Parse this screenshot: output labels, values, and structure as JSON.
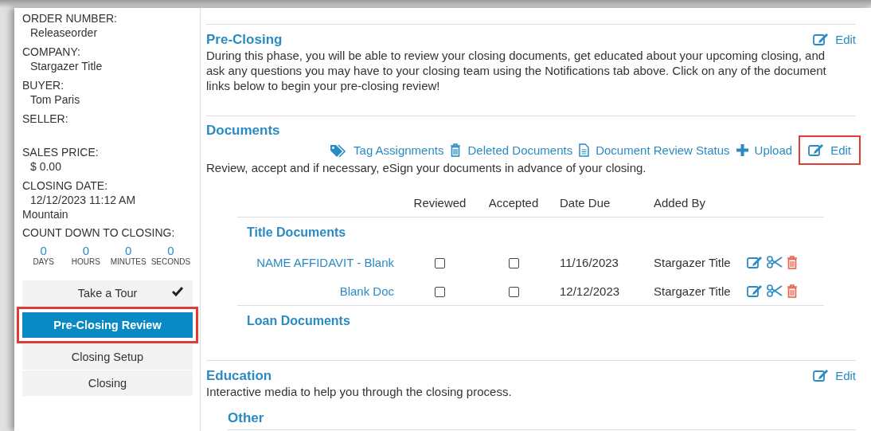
{
  "sidebar": {
    "fields": [
      {
        "label": "ORDER NUMBER:",
        "value": "Releaseorder"
      },
      {
        "label": "COMPANY:",
        "value": "Stargazer Title"
      },
      {
        "label": "BUYER:",
        "value": "Tom Paris"
      },
      {
        "label": "SELLER:"
      },
      {
        "label": "SALES PRICE:",
        "value": "$ 0.00"
      },
      {
        "label": "CLOSING DATE:",
        "value": "12/12/2023 11:12 AM",
        "continuation": "Mountain"
      }
    ],
    "countdown": {
      "label": "COUNT DOWN TO CLOSING:",
      "units": [
        {
          "value": "0",
          "label": "DAYS"
        },
        {
          "value": "0",
          "label": "HOURS"
        },
        {
          "value": "0",
          "label": "MINUTES"
        },
        {
          "value": "0",
          "label": "SECONDS"
        }
      ]
    },
    "nav": [
      {
        "label": "Take a Tour",
        "selected": false,
        "checked": true,
        "highlighted": false
      },
      {
        "label": "Pre-Closing Review",
        "selected": true,
        "checked": false,
        "highlighted": true
      },
      {
        "label": "Closing Setup",
        "selected": false,
        "checked": false,
        "highlighted": false
      },
      {
        "label": "Closing",
        "selected": false,
        "checked": false,
        "highlighted": false
      }
    ]
  },
  "pre_closing": {
    "title": "Pre-Closing",
    "edit": "Edit",
    "description": "During this phase, you will be able to review your closing documents, get educated about your upcoming closing, and ask any questions you may have to your closing team using the Notifications tab above. Click on any of the document links below to begin your pre-closing review!"
  },
  "documents": {
    "title": "Documents",
    "actions": [
      {
        "kind": "tag",
        "label": "Tag Assignments",
        "highlighted": false
      },
      {
        "kind": "trash",
        "label": "Deleted Documents",
        "highlighted": false
      },
      {
        "kind": "file",
        "label": "Document Review Status",
        "highlighted": false
      },
      {
        "kind": "plus",
        "label": "Upload",
        "highlighted": false
      },
      {
        "kind": "edit",
        "label": "Edit",
        "highlighted": true
      }
    ],
    "description": "Review, accept and if necessary, eSign your documents in advance of your closing.",
    "table": {
      "columns": [
        "Reviewed",
        "Accepted",
        "Date Due",
        "Added By"
      ],
      "groups": [
        {
          "title": "Title Documents",
          "rows": [
            {
              "name": "NAME AFFIDAVIT - Blank",
              "reviewed": false,
              "accepted": false,
              "date_due": "11/16/2023",
              "added_by": "Stargazer Title"
            },
            {
              "name": "Blank Doc",
              "reviewed": false,
              "accepted": false,
              "date_due": "12/12/2023",
              "added_by": "Stargazer Title"
            }
          ]
        },
        {
          "title": "Loan Documents"
        }
      ]
    }
  },
  "education": {
    "title": "Education",
    "edit": "Edit",
    "description": "Interactive media to help you through the closing process.",
    "groups": [
      {
        "title": "Other"
      }
    ]
  }
}
